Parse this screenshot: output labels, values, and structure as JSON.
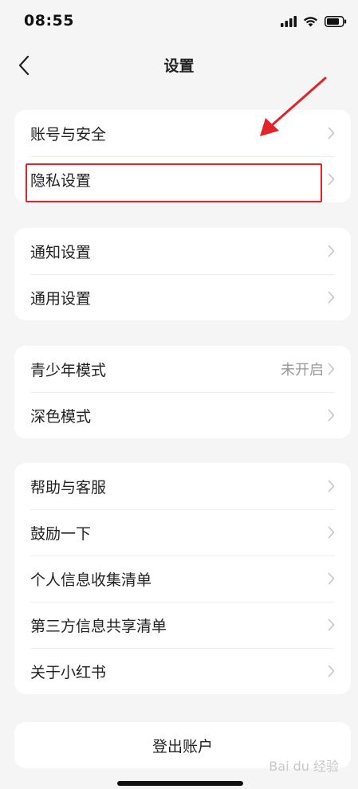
{
  "status_bar": {
    "time": "08:55"
  },
  "nav": {
    "title": "设置"
  },
  "groups": [
    {
      "items": [
        {
          "label": "账号与安全"
        },
        {
          "label": "隐私设置"
        }
      ]
    },
    {
      "items": [
        {
          "label": "通知设置"
        },
        {
          "label": "通用设置"
        }
      ]
    },
    {
      "items": [
        {
          "label": "青少年模式",
          "value": "未开启"
        },
        {
          "label": "深色模式"
        }
      ]
    },
    {
      "items": [
        {
          "label": "帮助与客服"
        },
        {
          "label": "鼓励一下"
        },
        {
          "label": "个人信息收集清单"
        },
        {
          "label": "第三方信息共享清单"
        },
        {
          "label": "关于小红书"
        }
      ]
    }
  ],
  "logout": {
    "label": "登出账户"
  },
  "annotation": {
    "highlight_color": "#e4222a"
  },
  "watermark": {
    "text": "Bai du 经验"
  },
  "colors": {
    "background": "#f5f5f5",
    "card": "#ffffff",
    "secondary_text": "#999999"
  }
}
